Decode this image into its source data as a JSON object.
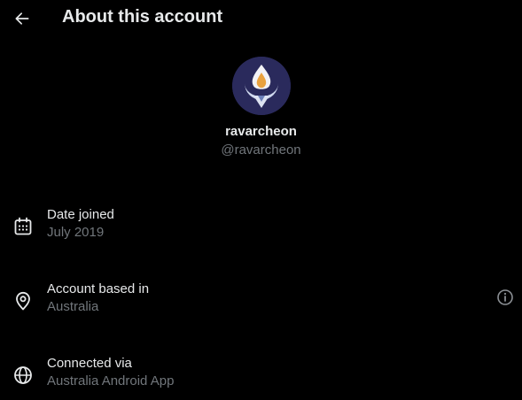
{
  "header": {
    "back_icon": "arrow-left-icon",
    "title": "About this account"
  },
  "profile": {
    "avatar_icon": "crescent-flame-emblem",
    "display_name": "ravarcheon",
    "handle": "@ravarcheon"
  },
  "details": {
    "date_joined": {
      "icon": "calendar-icon",
      "label": "Date joined",
      "value": "July 2019"
    },
    "based_in": {
      "icon": "location-pin-icon",
      "label": "Account based in",
      "value": "Australia",
      "info_icon": "info-icon"
    },
    "connected_via": {
      "icon": "globe-icon",
      "label": "Connected via",
      "value": "Australia Android App"
    }
  },
  "colors": {
    "background": "#000000",
    "primary_text": "#e7e9ea",
    "secondary_text": "#71767b",
    "avatar_background": "#2a2a5c"
  }
}
